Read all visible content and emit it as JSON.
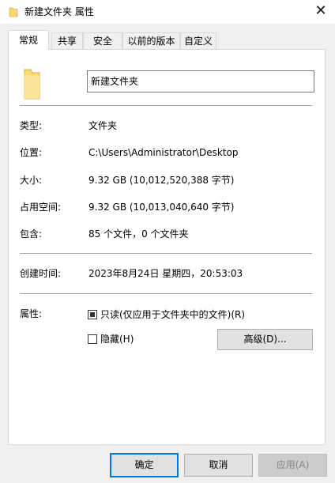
{
  "window": {
    "title": "新建文件夹 属性",
    "close_glyph": "✕"
  },
  "tabs": [
    {
      "label": "常规",
      "active": true
    },
    {
      "label": "共享",
      "active": false
    },
    {
      "label": "安全",
      "active": false
    },
    {
      "label": "以前的版本",
      "active": false
    },
    {
      "label": "自定义",
      "active": false
    }
  ],
  "general": {
    "folder_name": "新建文件夹",
    "type_label": "类型:",
    "type_value": "文件夹",
    "location_label": "位置:",
    "location_value": "C:\\Users\\Administrator\\Desktop",
    "size_label": "大小:",
    "size_value": "9.32 GB (10,012,520,388 字节)",
    "size_on_disk_label": "占用空间:",
    "size_on_disk_value": "9.32 GB (10,013,040,640 字节)",
    "contains_label": "包含:",
    "contains_value": "85 个文件，0 个文件夹",
    "created_label": "创建时间:",
    "created_value": "2023年8月24日 星期四，20:53:03",
    "attributes_label": "属性:",
    "readonly_label": "只读(仅应用于文件夹中的文件)(R)",
    "readonly_state": "indeterminate",
    "hidden_label": "隐藏(H)",
    "hidden_checked": false,
    "advanced_label": "高级(D)..."
  },
  "footer": {
    "ok_label": "确定",
    "cancel_label": "取消",
    "apply_label": "应用(A)"
  },
  "colors": {
    "accent": "#0078d7",
    "folder": "#f8d775"
  },
  "icons": {
    "title": "folder-icon",
    "main": "folder-icon",
    "close": "close-icon"
  }
}
